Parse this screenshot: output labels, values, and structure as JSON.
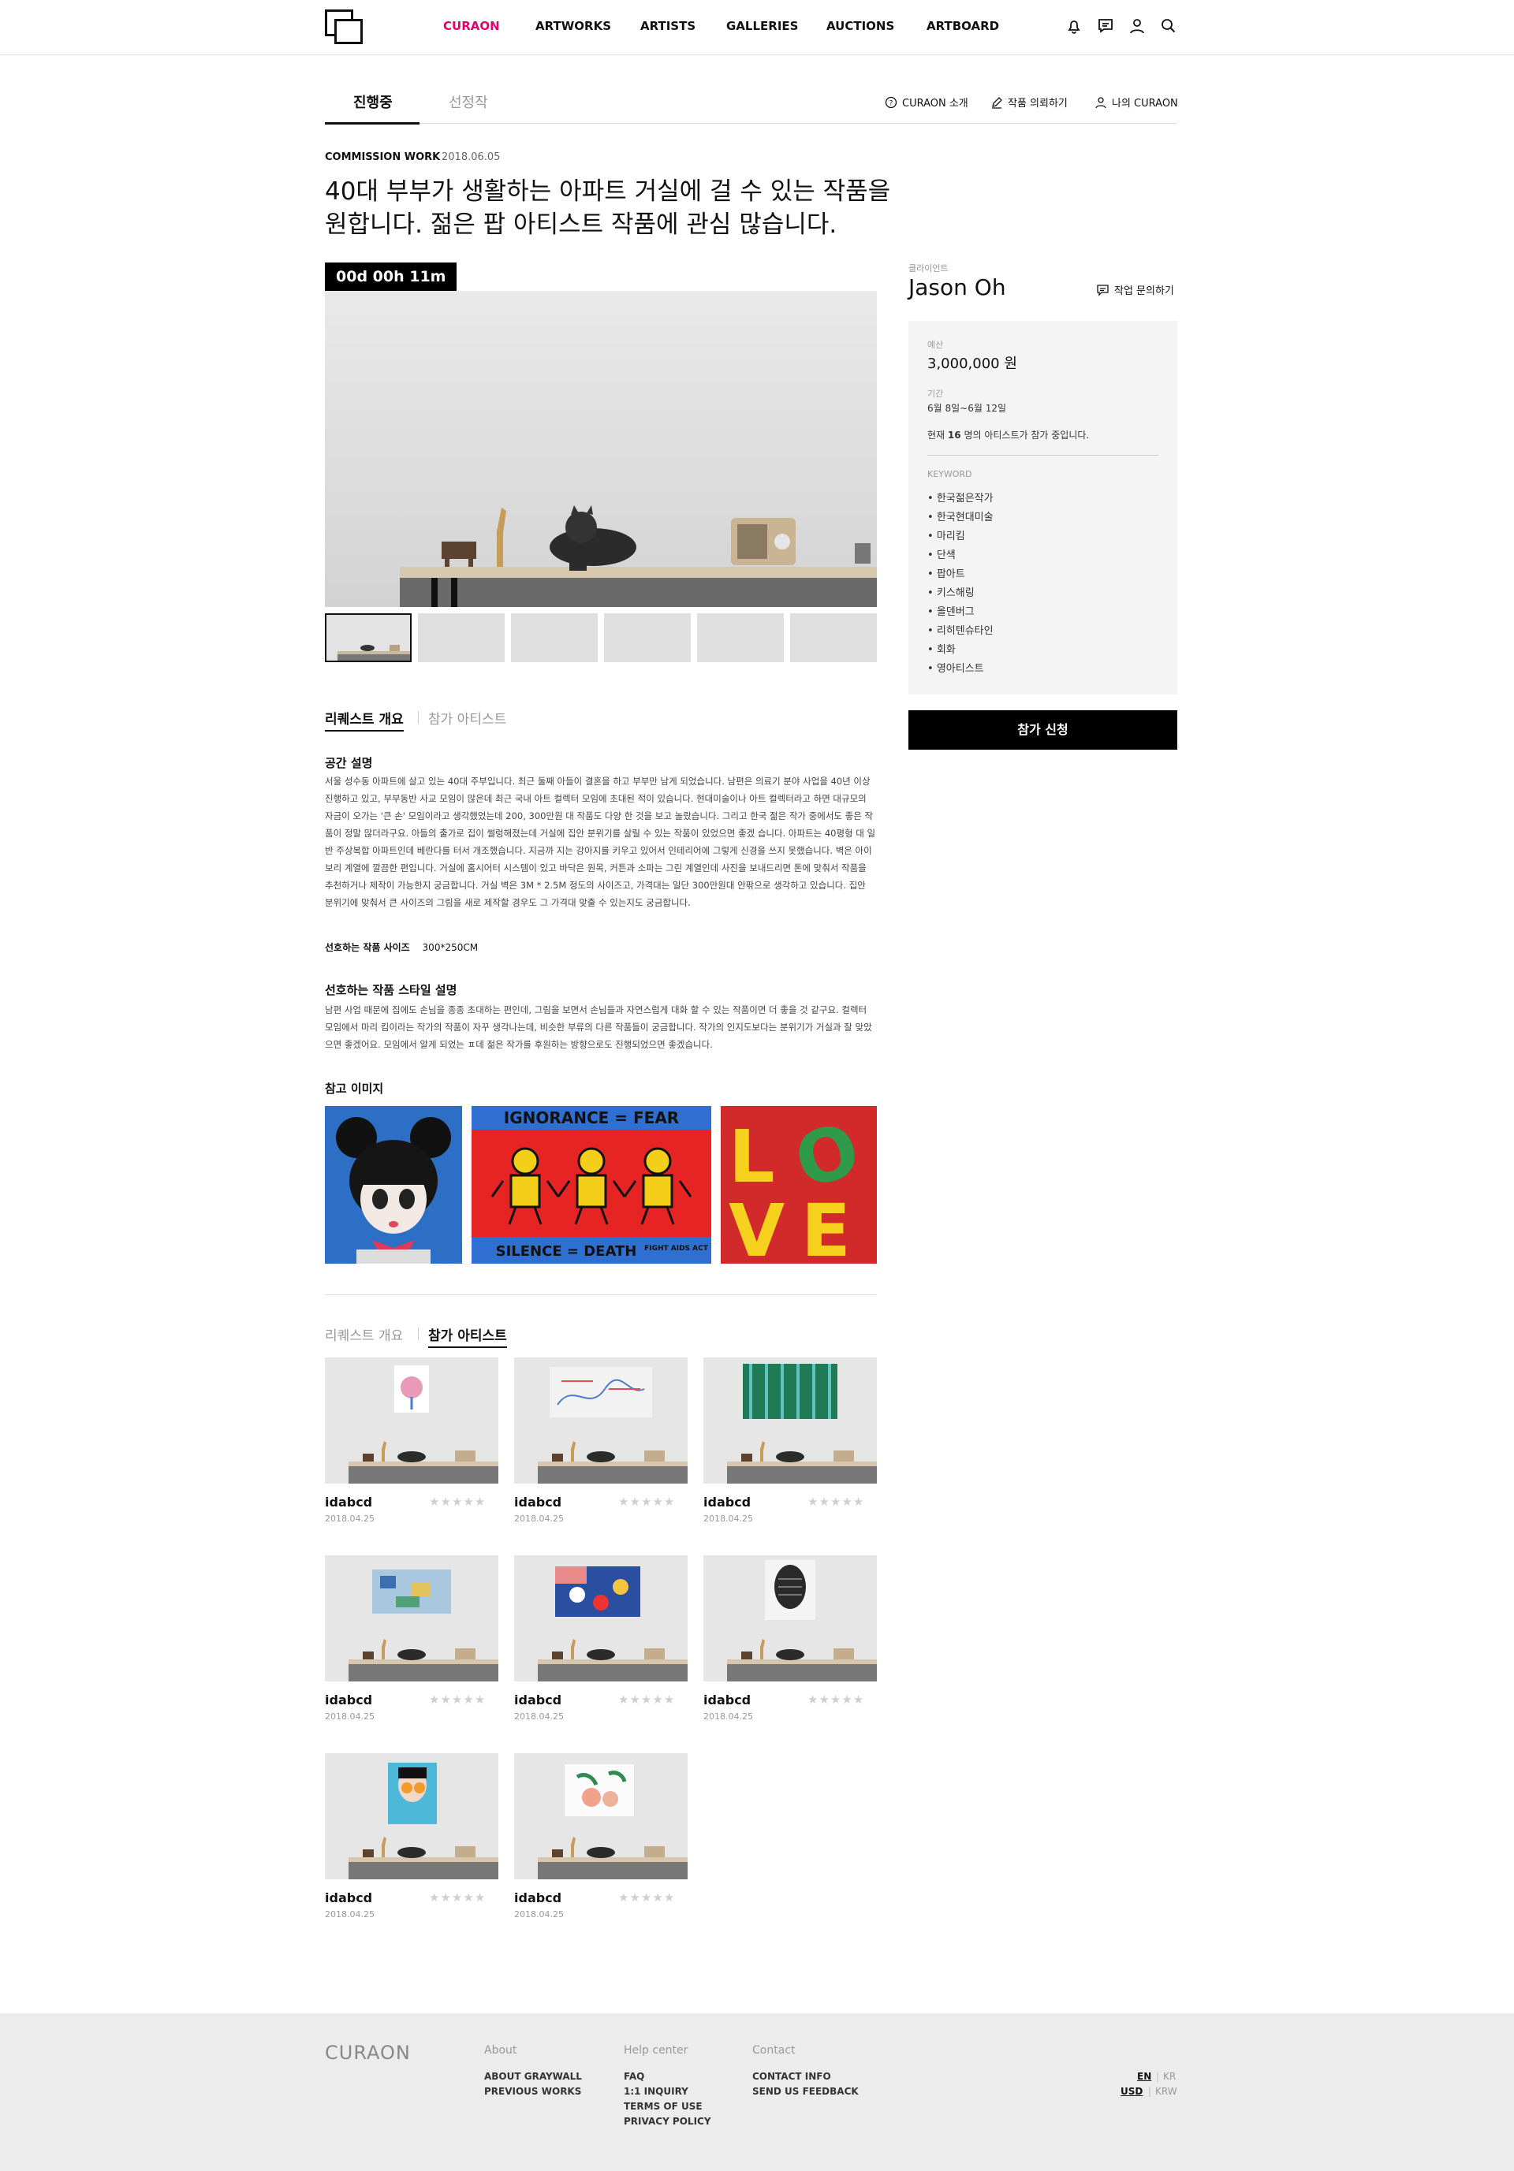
{
  "header": {
    "nav": [
      "CURAON",
      "ARTWORKS",
      "ARTISTS",
      "GALLERIES",
      "AUCTIONS",
      "ARTBOARD"
    ],
    "active_nav": "CURAON",
    "icons": [
      "bell-icon",
      "message-icon",
      "user-icon",
      "search-icon"
    ],
    "accent_color": "#e6006e"
  },
  "page_tabs": {
    "active": "진행중",
    "other": "선정작"
  },
  "top_links": [
    "CURAON 소개",
    "작품 의뢰하기",
    "나의 CURAON"
  ],
  "request": {
    "type": "COMMISSION WORK",
    "date": "2018.06.05",
    "title": "40대 부부가 생활하는 아파트 거실에 걸 수 있는 작품을 원합니다. 젊은 팝 아티스트 작품에 관심 많습니다.",
    "timer": "00d 00h 11m"
  },
  "client": {
    "label": "클라이언트",
    "name": "Jason Oh",
    "inquiry_label": "작업 문의하기"
  },
  "panel": {
    "budget_label": "예산",
    "budget": "3,000,000 원",
    "period_label": "기간",
    "period": "6월 8일~6월 12일",
    "participants_prefix": "현재",
    "participants_count": "16",
    "participants_suffix": "명의 아티스트가 참가 중입니다.",
    "keyword_label": "KEYWORD",
    "keywords": [
      "한국젊은작가",
      "한국현대미술",
      "마리킴",
      "단색",
      "팝아트",
      "키스해링",
      "올덴버그",
      "리히텐슈타인",
      "회화",
      "영아티스트"
    ]
  },
  "apply_button": "참가 신청",
  "section_tabs": {
    "overview": "리퀘스트 개요",
    "artists": "참가 아티스트"
  },
  "space": {
    "heading": "공간 설명",
    "text": "서울 성수동 아파트에 살고 있는 40대 주부입니다. 최근 둘째 아들이 결혼을 하고 부부만 남게 되었습니다. 남편은 의료기 분야 사업을 40년 이상 진행하고 있고, 부부동반 사교 모임이 많은데 최근 국내 아트 컬렉터 모임에 초대된 적이 있습니다. 현대미술이나 아트 컬렉터라고 하면 대규모의 자금이 오가는 '큰 손' 모임이라고 생각했었는데 200, 300만원 대 작품도 다양 한 것을 보고 놀랐습니다. 그리고 한국 젊은 작가 중에서도 좋은 작품이 정말 많더라구요. 아들의 출가로 집이 썰렁해졌는데 거실에 집안 분위기를 살릴 수 있는 작품이 있었으면 좋겠 습니다. 아파트는 40평형 대 일반 주상복합 아파트인데 베란다를 터서 개조했습니다. 지금까 지는 강아지를 키우고 있어서 인테리어에 그렇게 신경을 쓰지 못했습니다. 벽은 아이보리 계열에 깔끔한 편입니다. 거실에 홈시어터 시스템이 있고 바닥은 원목, 커튼과 소파는 그린 계열인데 사진을 보내드리면 톤에 맞춰서 작품을 추천하거나 제작이 가능한지 궁금합니다. 거실 벽은 3M * 2.5M 정도의 사이즈고, 가격대는 일단 300만원대 안팎으로 생각하고 있습니다. 집안 분위기에 맞춰서 큰 사이즈의 그림을 새로 제작할 경우도 그 가격대 맞출 수 있는지도 궁금합니다.",
    "size_label": "선호하는 작품 사이즈",
    "size_value": "300*250CM"
  },
  "style": {
    "heading": "선호하는 작품 스타일 설명",
    "text": "남편 사업 때문에 집에도 손님을 종종 초대하는 편인데, 그림을 보면서 손님들과 자연스럽게 대화 할 수 있는 작품이면 더 좋을 것 같구요. 컬렉터 모임에서 마리 킴이라는 작가의 작품이 자꾸 생각나는데, 비슷한 부류의 다른 작품들이 궁금합니다. 작가의 인지도보다는 분위기가 거실과 잘 맞았으면 좋겠어요. 모임에서 알게 되었는 ㅍ데 젊은 작가를 후원하는 방향으로도 진행되었으면 좋겠습니다."
  },
  "reference": {
    "heading": "참고 이미지",
    "keith_top": "IGNORANCE = FEAR",
    "keith_bottom": "SILENCE = DEATH",
    "keith_note": "FIGHT AIDS ACT UP",
    "love_letters": [
      "L",
      "O",
      "V",
      "E"
    ]
  },
  "artists": [
    {
      "name": "idabcd",
      "date": "2018.04.25",
      "rating": 0,
      "art": "pink-flower"
    },
    {
      "name": "idabcd",
      "date": "2018.04.25",
      "rating": 0,
      "art": "sketch"
    },
    {
      "name": "idabcd",
      "date": "2018.04.25",
      "rating": 0,
      "art": "green-abstract"
    },
    {
      "name": "idabcd",
      "date": "2018.04.25",
      "rating": 0,
      "art": "blue-collage"
    },
    {
      "name": "idabcd",
      "date": "2018.04.25",
      "rating": 0,
      "art": "pop-flowers"
    },
    {
      "name": "idabcd",
      "date": "2018.04.25",
      "rating": 0,
      "art": "dark-head"
    },
    {
      "name": "idabcd",
      "date": "2018.04.25",
      "rating": 0,
      "art": "sunglasses-girl"
    },
    {
      "name": "idabcd",
      "date": "2018.04.25",
      "rating": 0,
      "art": "peach-leaves"
    }
  ],
  "footer": {
    "logo": "CURAON",
    "about_heading": "About",
    "about_links": [
      "ABOUT GRAYWALL",
      "PREVIOUS WORKS"
    ],
    "help_heading": "Help center",
    "help_links": [
      "FAQ",
      "1:1 INQUIRY",
      "TERMS OF USE",
      "PRIVACY POLICY"
    ],
    "contact_heading": "Contact",
    "contact_links": [
      "CONTACT INFO",
      "SEND US FEEDBACK"
    ],
    "lang": [
      "EN",
      "KR"
    ],
    "currency": [
      "USD",
      "KRW"
    ]
  }
}
